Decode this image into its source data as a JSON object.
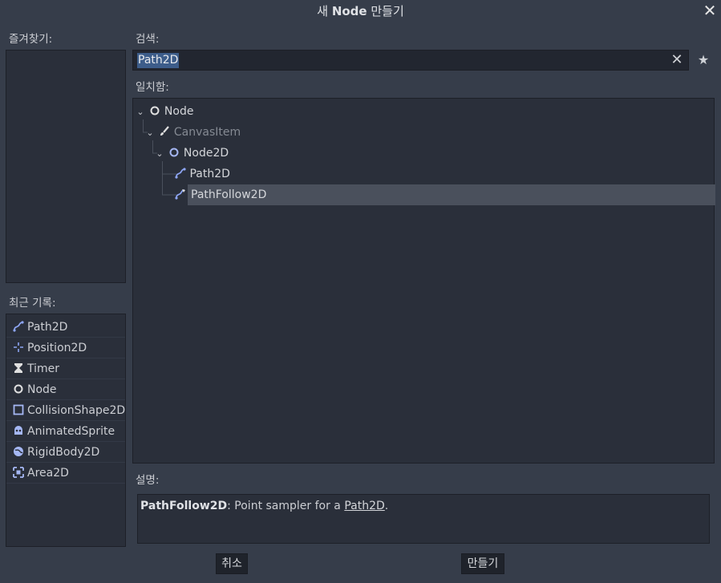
{
  "window": {
    "title_prefix": "새",
    "title_bold": "Node",
    "title_suffix": "만들기"
  },
  "favorites": {
    "label": "즐겨찾기:"
  },
  "search": {
    "label": "검색:",
    "value": "Path2D"
  },
  "matches": {
    "label": "일치함:",
    "tree": [
      {
        "label": "Node",
        "icon": "circle-icon",
        "dim": false
      },
      {
        "label": "CanvasItem",
        "icon": "brush-icon",
        "dim": true
      },
      {
        "label": "Node2D",
        "icon": "circle-icon",
        "dim": false
      },
      {
        "label": "Path2D",
        "icon": "path-icon",
        "dim": false
      },
      {
        "label": "PathFollow2D",
        "icon": "path-follow-icon",
        "dim": false,
        "selected": true
      }
    ]
  },
  "recent": {
    "label": "최근 기록:",
    "items": [
      {
        "label": "Path2D",
        "icon": "path-icon"
      },
      {
        "label": "Position2D",
        "icon": "position-icon"
      },
      {
        "label": "Timer",
        "icon": "hourglass-icon"
      },
      {
        "label": "Node",
        "icon": "circle-icon"
      },
      {
        "label": "CollisionShape2D",
        "icon": "collision-shape-icon"
      },
      {
        "label": "AnimatedSprite",
        "icon": "animated-sprite-icon"
      },
      {
        "label": "RigidBody2D",
        "icon": "rigid-body-icon"
      },
      {
        "label": "Area2D",
        "icon": "area-icon"
      }
    ]
  },
  "description": {
    "label": "설명:",
    "class_name": "PathFollow2D",
    "text": ": Point sampler for a ",
    "link": "Path2D",
    "end": "."
  },
  "buttons": {
    "cancel": "취소",
    "create": "만들기"
  },
  "colors": {
    "accent_blue": "#8da5f3",
    "selection": "#4a505c",
    "highlight": "#3d5d8a"
  }
}
